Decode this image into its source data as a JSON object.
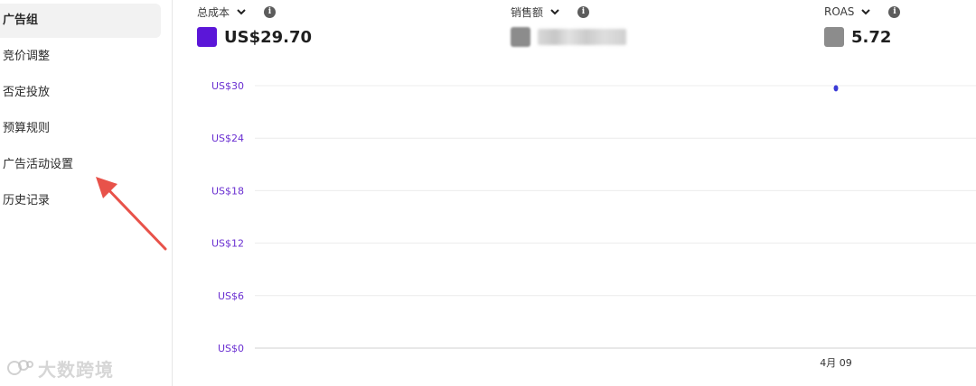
{
  "sidebar": {
    "items": [
      {
        "label": "广告组",
        "active": true
      },
      {
        "label": "竞价调整",
        "active": false
      },
      {
        "label": "否定投放",
        "active": false
      },
      {
        "label": "预算规则",
        "active": false
      },
      {
        "label": "广告活动设置",
        "active": false
      },
      {
        "label": "历史记录",
        "active": false
      }
    ]
  },
  "watermark": {
    "text": "大数跨境"
  },
  "metrics": [
    {
      "label": "总成本",
      "value": "US$29.70",
      "color": "#5b16d8",
      "icon": "info-icon"
    },
    {
      "label": "销售额",
      "value": "",
      "color": "#8c8c8c",
      "icon": "info-icon",
      "blurred": true
    },
    {
      "label": "ROAS",
      "value": "5.72",
      "color": "#8c8c8c",
      "icon": "info-icon"
    }
  ],
  "chart_data": {
    "type": "line",
    "x": [
      "4月 09"
    ],
    "series": [
      {
        "values": [
          29.7
        ],
        "color": "#3b3bd6"
      }
    ],
    "yticks": [
      "US$0",
      "US$6",
      "US$12",
      "US$18",
      "US$24",
      "US$30"
    ],
    "ylim": [
      0,
      30
    ],
    "xlabel": "",
    "ylabel": "",
    "grid": true,
    "accent": "#6a2fd1"
  }
}
